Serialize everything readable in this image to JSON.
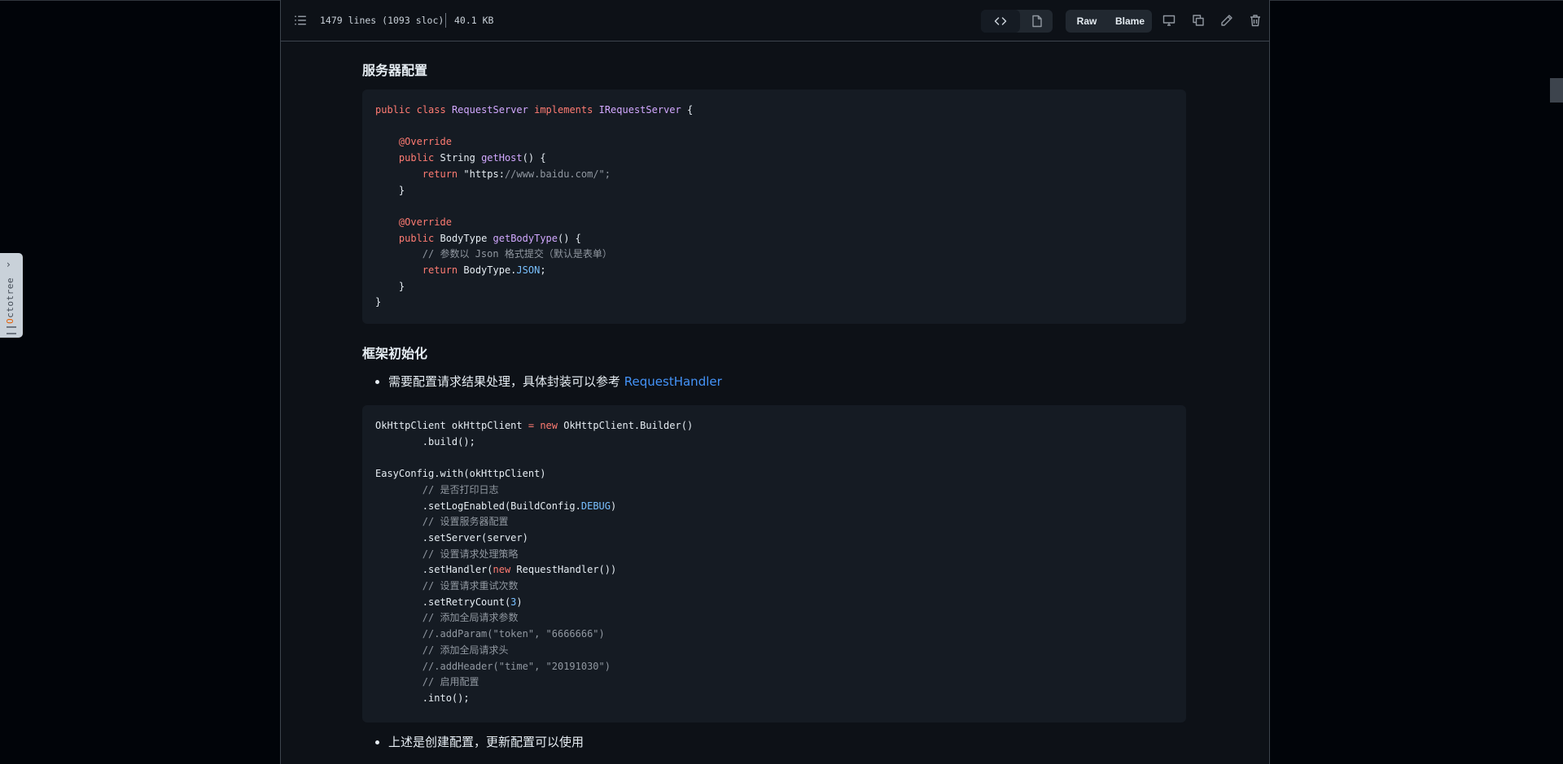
{
  "octotree": {
    "label": "Octotree"
  },
  "file_header": {
    "lines_info": "1479 lines (1093 sloc)",
    "size_info": "40.1 KB",
    "raw_label": "Raw",
    "blame_label": "Blame"
  },
  "content": {
    "heading_server_config": "服务器配置",
    "code1": [
      "public class RequestServer implements IRequestServer {",
      "",
      "    @Override",
      "    public String getHost() {",
      "        return \"https://www.baidu.com/\";",
      "    }",
      "",
      "    @Override",
      "    public BodyType getBodyType() {",
      "        // 参数以 Json 格式提交（默认是表单）",
      "        return BodyType.JSON;",
      "    }",
      "}"
    ],
    "heading_framework_init": "框架初始化",
    "bullet1_text": "需要配置请求结果处理，具体封装可以参考 ",
    "bullet1_link": "RequestHandler",
    "code2": [
      "OkHttpClient okHttpClient = new OkHttpClient.Builder()",
      "        .build();",
      "",
      "EasyConfig.with(okHttpClient)",
      "        // 是否打印日志",
      "        .setLogEnabled(BuildConfig.DEBUG)",
      "        // 设置服务器配置",
      "        .setServer(server)",
      "        // 设置请求处理策略",
      "        .setHandler(new RequestHandler())",
      "        // 设置请求重试次数",
      "        .setRetryCount(3)",
      "        // 添加全局请求参数",
      "        //.addParam(\"token\", \"6666666\")",
      "        // 添加全局请求头",
      "        //.addHeader(\"time\", \"20191030\")",
      "        // 启用配置",
      "        .into();"
    ],
    "bullet2_text": "上述是创建配置，更新配置可以使用"
  },
  "colors": {
    "background": "#0d1117",
    "code_bg": "#151b23",
    "keyword": "#ff7b72",
    "type": "#d2a8ff",
    "string": "#a5d6ff",
    "comment": "#9198a1",
    "constant": "#79c0ff",
    "link": "#4493f8"
  },
  "icons": [
    "list-unordered-icon",
    "code-icon",
    "file-icon",
    "desktop-icon",
    "copy-icon",
    "pencil-icon",
    "trash-icon",
    "chevron-right-icon",
    "grabber-icon"
  ]
}
